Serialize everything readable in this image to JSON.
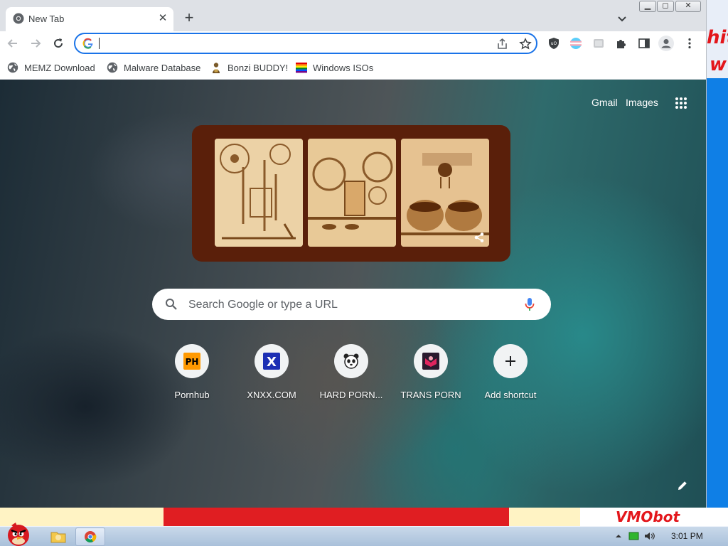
{
  "browser": {
    "tab_title": "New Tab",
    "omnibox_value": "",
    "bookmarks": [
      {
        "label": "MEMZ Download",
        "icon": "globe-icon"
      },
      {
        "label": "Malware Database",
        "icon": "globe-icon"
      },
      {
        "label": "Bonzi BUDDY!",
        "icon": "bonzi-icon"
      },
      {
        "label": "Windows ISOs",
        "icon": "rainbow-flag-icon"
      }
    ]
  },
  "newtab": {
    "links": {
      "gmail": "Gmail",
      "images": "Images"
    },
    "search_placeholder": "Search Google or type a URL",
    "shortcuts": [
      {
        "label": "Pornhub",
        "icon": "ph-logo-icon",
        "icon_text": "PH"
      },
      {
        "label": "XNXX.COM",
        "icon": "x-logo-icon",
        "icon_text": "X"
      },
      {
        "label": "HARD PORN...",
        "icon": "panda-icon"
      },
      {
        "label": "TRANS PORN",
        "icon": "trans-site-icon"
      },
      {
        "label": "Add shortcut",
        "icon": "plus-icon"
      }
    ]
  },
  "desktop": {
    "scrawl_right": [
      "hit",
      "w"
    ],
    "scrawl_bottom": "VMObot"
  },
  "taskbar": {
    "clock": "3:01 PM"
  },
  "colors": {
    "accent": "#1a73e8",
    "doodle_frame": "#5a1f0a",
    "wall_red": "#e3161b",
    "wall_blue": "#0f7fe6"
  }
}
